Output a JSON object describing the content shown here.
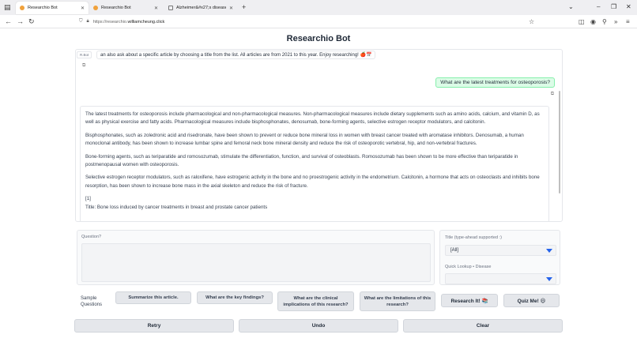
{
  "browser": {
    "tabs": [
      {
        "label": "Researchio Bot",
        "active": true
      },
      {
        "label": "Researchio Bot",
        "active": false
      },
      {
        "label": "Alzheimer&#x27;s disease ·",
        "active": false
      }
    ],
    "url_prefix": "https://researchio.",
    "url_host": "williamcheung.click"
  },
  "page": {
    "title": "Researchio Bot"
  },
  "chat": {
    "label": "R.Bot",
    "intro": "an also ask about a specific article by choosing a title from the list. All articles are from 2021 to this year. Enjoy researching! 🍎📅",
    "user_message": "What are the latest treatments for osteoporosis?",
    "answer": [
      "The latest treatments for osteoporosis include pharmacological and non-pharmacological measures. Non-pharmacological measures include dietary supplements such as amino acids, calcium, and vitamin D, as well as physical exercise and fatty acids. Pharmacological measures include bisphosphonates, denosumab, bone-forming agents, selective estrogen receptor modulators, and calcitonin.",
      "Bisphosphonates, such as zoledronic acid and risedronate, have been shown to prevent or reduce bone mineral loss in women with breast cancer treated with aromatase inhibitors. Denosumab, a human monoclonal antibody, has been shown to increase lumbar spine and femoral neck bone mineral density and reduce the risk of osteoporotic vertebral, hip, and non-vertebral fractures.",
      "Bone-forming agents, such as teriparatide and romosozumab, stimulate the differentiation, function, and survival of osteoblasts. Romosozumab has been shown to be more effective than teriparatide in postmenopausal women with osteoporosis.",
      "Selective estrogen receptor modulators, such as raloxifene, have estrogenic activity in the bone and no proestrogenic activity in the endometrium. Calcitonin, a hormone that acts on osteoclasts and inhibits bone resorption, has been shown to increase bone mass in the axial skeleton and reduce the risk of fracture.",
      "[1]",
      "Title: Bone loss induced by cancer treatments in breast and prostate cancer patients"
    ]
  },
  "form": {
    "question_label": "Question?",
    "question_value": "",
    "title_label": "Title   (type-ahead supported :)",
    "title_value": "[All]",
    "lookup_label": "Quick Lookup • Disease",
    "lookup_value": ""
  },
  "samples": {
    "label": "Sample Questions",
    "buttons": [
      "Summarize this article.",
      "What are the key findings?",
      "What are the clinical implications of this research?",
      "What are the limitations of this research?"
    ]
  },
  "actions": {
    "research": "Research It! 📚",
    "quiz": "Quiz Me! 😃",
    "retry": "Retry",
    "undo": "Undo",
    "clear": "Clear"
  }
}
